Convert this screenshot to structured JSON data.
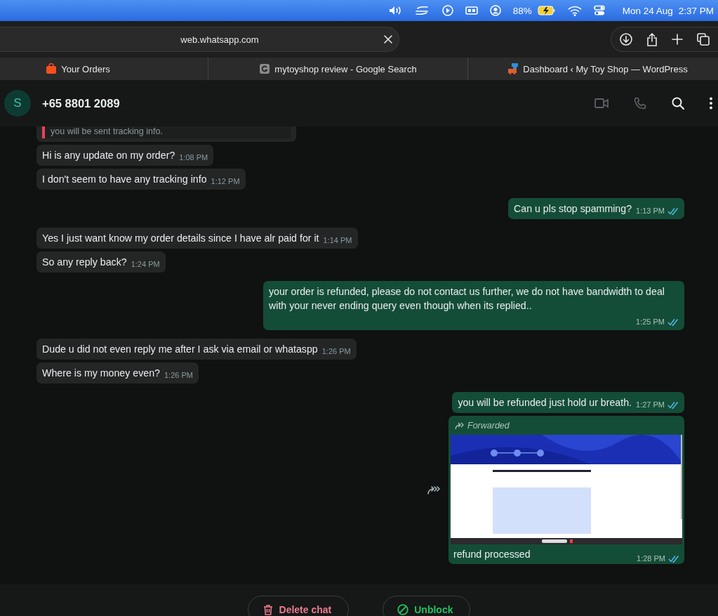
{
  "menu_bar": {
    "battery": "88%",
    "date": "Mon 24 Aug",
    "time": "2:37 PM"
  },
  "browser": {
    "url": "web.whatsapp.com",
    "tabs": [
      {
        "title": "Your Orders"
      },
      {
        "title": "mytoyshop review - Google Search"
      },
      {
        "title": "Dashboard ‹ My Toy Shop — WordPress"
      }
    ]
  },
  "chat": {
    "contact": {
      "initial": "S",
      "name": "+65 8801 2089"
    },
    "messages": [
      {
        "kind": "quote",
        "outgoing": false,
        "text": "you will be sent tracking info."
      },
      {
        "kind": "text",
        "outgoing": false,
        "text": "Hi is any update on my order?",
        "time": "1:08 PM"
      },
      {
        "kind": "text",
        "outgoing": false,
        "text": "I don't seem to have any tracking info",
        "time": "1:12 PM"
      },
      {
        "kind": "text",
        "outgoing": true,
        "text": "Can u pls stop spamming?",
        "time": "1:13 PM",
        "read": true
      },
      {
        "kind": "text",
        "outgoing": false,
        "text": "Yes I just want know my order details since I have alr paid for it",
        "time": "1:14 PM"
      },
      {
        "kind": "text",
        "outgoing": false,
        "text": "So any reply back?",
        "time": "1:24 PM"
      },
      {
        "kind": "text",
        "outgoing": true,
        "text": "your order is refunded, please do not contact us further, we do not have bandwidth to deal with your never ending query even though when its replied..",
        "time": "1:25 PM",
        "read": true
      },
      {
        "kind": "text",
        "outgoing": false,
        "text": "Dude u did not even reply me after I ask via email or whataspp",
        "time": "1:26 PM"
      },
      {
        "kind": "text",
        "outgoing": false,
        "text": "Where is my money even?",
        "time": "1:26 PM"
      },
      {
        "kind": "text",
        "outgoing": true,
        "text": "you will be refunded just hold ur breath.",
        "time": "1:27 PM",
        "read": true
      },
      {
        "outgoing": true,
        "forwarded_label": "Forwarded",
        "caption": "refund processed",
        "time": "1:28 PM",
        "read": true
      }
    ]
  },
  "footer": {
    "buttons": [
      {
        "kind": "delete",
        "label": "Delete chat"
      },
      {
        "kind": "unblock",
        "label": "Unblock"
      }
    ]
  }
}
